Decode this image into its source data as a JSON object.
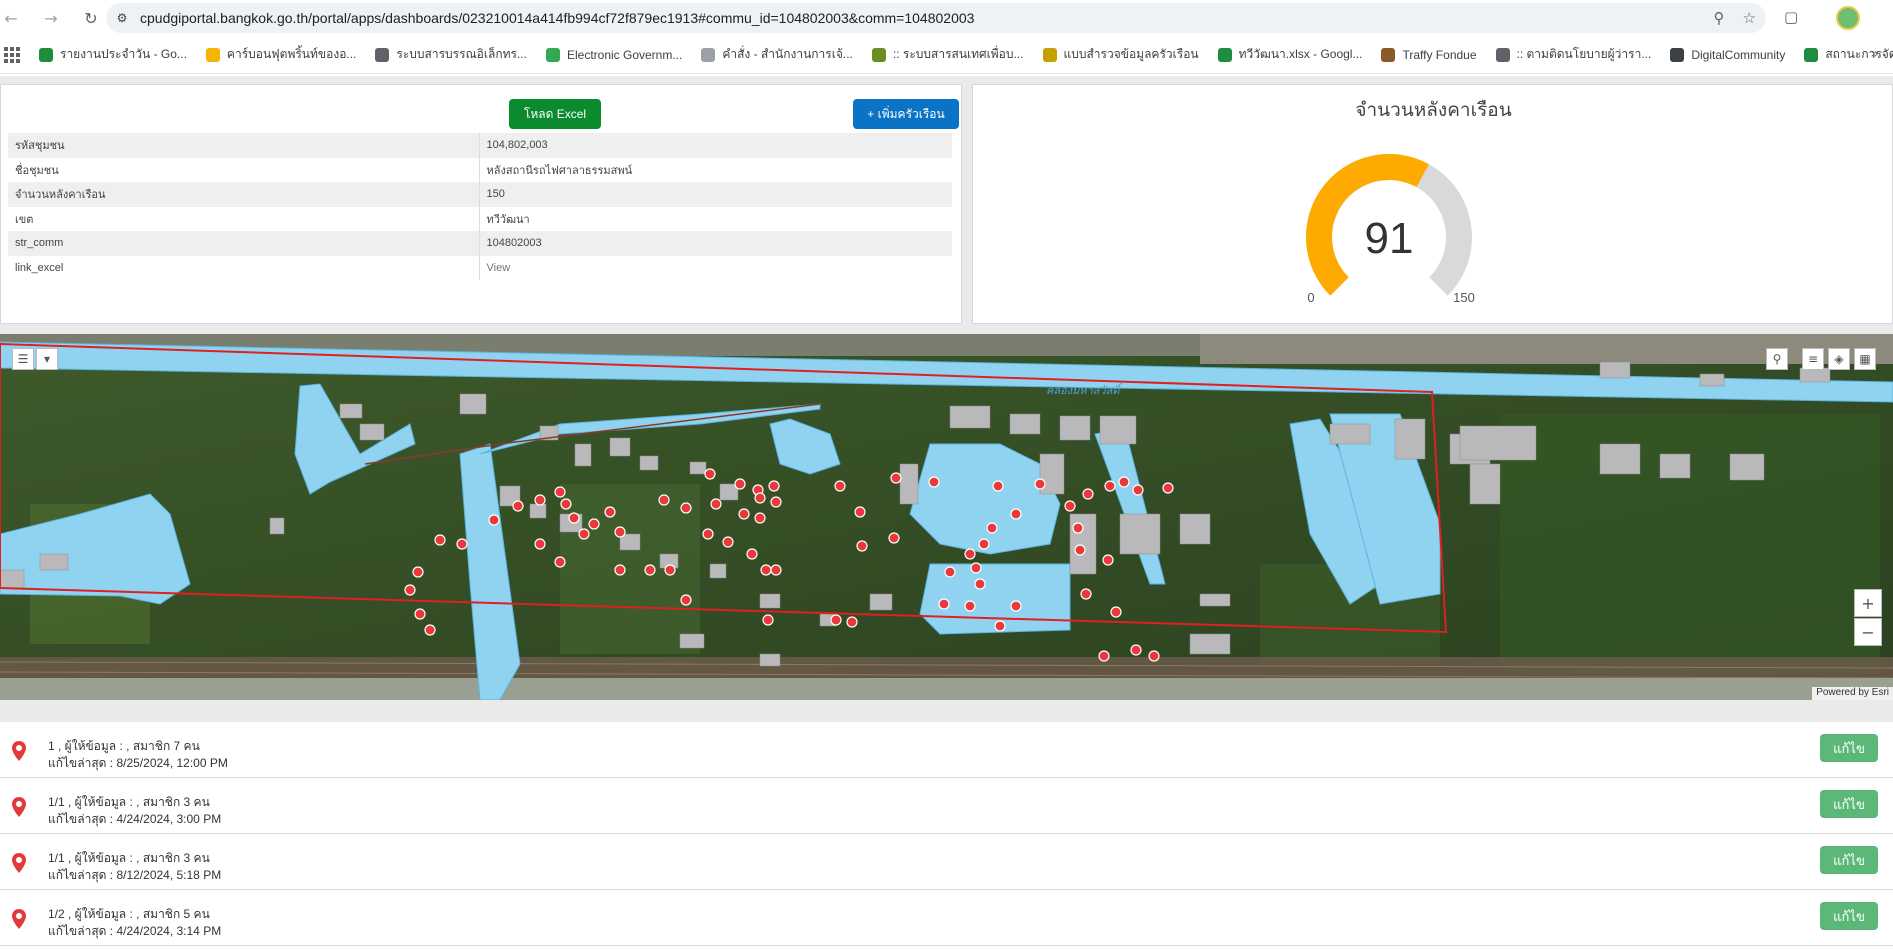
{
  "browser": {
    "url": "cpudgiportal.bangkok.go.th/portal/apps/dashboards/023210014a414fb994cf72f879ec1913#commu_id=104802003&comm=104802003",
    "bookmarks": [
      {
        "label": "รายงานประจำวัน - Go...",
        "color": "#1e8e3e"
      },
      {
        "label": "คาร์บอนฟุตพริ้นท์ของอ...",
        "color": "#f4b400"
      },
      {
        "label": "ระบบสารบรรณอิเล็กทร...",
        "color": "#5f6368"
      },
      {
        "label": "Electronic Governm...",
        "color": "#34a853"
      },
      {
        "label": "คำสั่ง - สำนักงานการเจ้...",
        "color": "#9aa0a6"
      },
      {
        "label": ":: ระบบสารสนเทศเพื่อบ...",
        "color": "#6b8e23"
      },
      {
        "label": "แบบสำรวจข้อมูลครัวเรือน",
        "color": "#c5a000"
      },
      {
        "label": "ทวีวัฒนา.xlsx - Googl...",
        "color": "#1e8e3e"
      },
      {
        "label": "Traffy Fondue",
        "color": "#8b5a2b"
      },
      {
        "label": ":: ตามติดนโยบายผู้ว่ารา...",
        "color": "#5f6368"
      },
      {
        "label": "DigitalCommunity",
        "color": "#3c4043"
      },
      {
        "label": "สถานะการจัดส่งแบบ ป...",
        "color": "#1e8e3e"
      }
    ]
  },
  "info_panel": {
    "excel_button": "โหลด Excel",
    "add_button": "+ เพิ่มครัวเรือน",
    "rows": [
      {
        "key": "รหัสชุมชน",
        "value": "104,802,003"
      },
      {
        "key": "ชื่อชุมชน",
        "value": "หลังสถานีรถไฟศาลาธรรมสพน์"
      },
      {
        "key": "จำนวนหลังคาเรือน",
        "value": "150"
      },
      {
        "key": "เขต",
        "value": "ทวีวัฒนา"
      },
      {
        "key": "str_comm",
        "value": "104802003"
      },
      {
        "key": "link_excel",
        "value": "View"
      }
    ]
  },
  "gauge": {
    "title": "จำนวนหลังคาเรือน",
    "value": 91,
    "min": 0,
    "max": 150,
    "value_label": "91",
    "min_label": "0",
    "max_label": "150",
    "fill_color": "#ffaa00",
    "track_color": "#d9d9d9"
  },
  "map": {
    "canal_label": "คลองมหาสวัสดิ์",
    "attribution": "Powered by Esri",
    "zoom_in": "+",
    "zoom_out": "−"
  },
  "list": [
    {
      "title": "1 , ผู้ให้ข้อมูล : , สมาชิก 7  คน",
      "subtitle": "แก้ไขล่าสุด : 8/25/2024, 12:00 PM",
      "button": "แก้ไข"
    },
    {
      "title": "1/1 , ผู้ให้ข้อมูล : , สมาชิก 3  คน",
      "subtitle": "แก้ไขล่าสุด : 4/24/2024, 3:00 PM",
      "button": "แก้ไข"
    },
    {
      "title": "1/1 , ผู้ให้ข้อมูล : , สมาชิก 3  คน",
      "subtitle": "แก้ไขล่าสุด : 8/12/2024, 5:18 PM",
      "button": "แก้ไข"
    },
    {
      "title": "1/2 , ผู้ให้ข้อมูล : , สมาชิก 5  คน",
      "subtitle": "แก้ไขล่าสุด : 4/24/2024, 3:14 PM",
      "button": "แก้ไข"
    }
  ]
}
